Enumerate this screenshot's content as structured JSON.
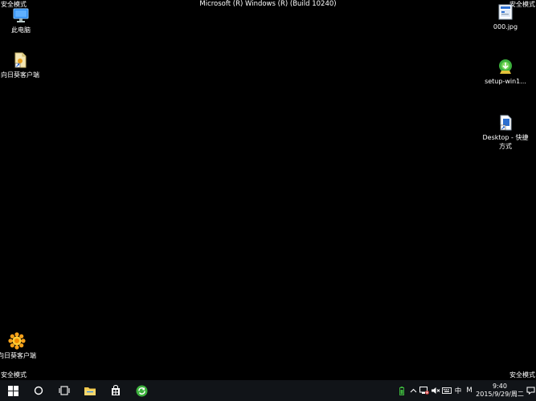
{
  "screen": {
    "title": "Microsoft (R) Windows (R) (Build 10240)",
    "safe_mode_label": "安全模式"
  },
  "desktop_icons": [
    {
      "label": "此电脑",
      "icon": "this-pc-icon"
    },
    {
      "label": "向日葵客户端",
      "icon": "file-shortcut-icon"
    },
    {
      "label": "向日葵客户端",
      "icon": "sunflower-icon"
    },
    {
      "label": "000.jpg",
      "icon": "image-file-icon"
    },
    {
      "label": "setup-win1...",
      "icon": "setup-installer-icon"
    },
    {
      "label": "Desktop - 快捷方式",
      "icon": "shortcut-icon"
    }
  ],
  "taskbar": {
    "buttons": [
      {
        "name": "start-button",
        "icon": "windows-logo-icon"
      },
      {
        "name": "search-button",
        "icon": "cortana-circle-icon"
      },
      {
        "name": "task-view-button",
        "icon": "task-view-icon"
      },
      {
        "name": "file-explorer-button",
        "icon": "folder-icon"
      },
      {
        "name": "store-button",
        "icon": "store-bag-icon"
      },
      {
        "name": "app-button",
        "icon": "green-refresh-icon"
      }
    ],
    "tray": {
      "ime_label": "中",
      "ime_mode": "M",
      "time": "9:40",
      "date": "2015/9/29/周二"
    }
  },
  "colors": {
    "background": "#000000",
    "taskbar": "#111418",
    "accent_blue": "#2d8cf0",
    "sunflower": "#f7a21a",
    "green": "#3cb13c"
  }
}
